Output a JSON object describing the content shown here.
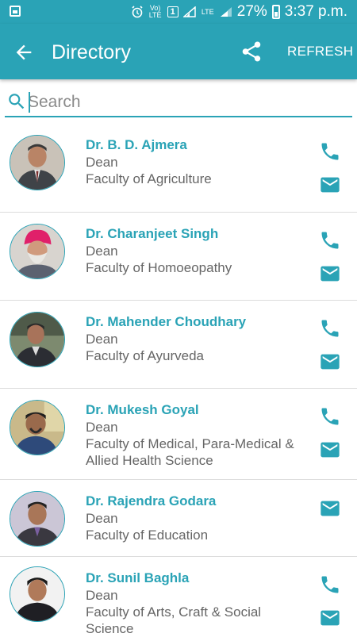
{
  "status_bar": {
    "volte": "Vo) LTE",
    "sim": "1",
    "lte": "LTE",
    "battery_percent": "27%",
    "time": "3:37 p.m."
  },
  "app_bar": {
    "title": "Directory",
    "refresh_label": "REFRESH"
  },
  "search": {
    "placeholder": "Search"
  },
  "colors": {
    "primary": "#2aa3b6",
    "text_secondary": "#666666"
  },
  "contacts": [
    {
      "name": "Dr. B. D. Ajmera",
      "designation": "Dean",
      "faculty": "Faculty of Agriculture",
      "has_phone": true
    },
    {
      "name": "Dr. Charanjeet Singh",
      "designation": "Dean",
      "faculty": "Faculty of Homoeopathy",
      "has_phone": true
    },
    {
      "name": "Dr. Mahender Choudhary",
      "designation": "Dean",
      "faculty": "Faculty of Ayurveda",
      "has_phone": true
    },
    {
      "name": "Dr. Mukesh Goyal",
      "designation": "Dean",
      "faculty": "Faculty of Medical, Para-Medical & Allied Health Science",
      "has_phone": true
    },
    {
      "name": "Dr. Rajendra Godara",
      "designation": "Dean",
      "faculty": "Faculty of Education",
      "has_phone": false
    },
    {
      "name": "Dr. Sunil Baghla",
      "designation": "Dean",
      "faculty": "Faculty of Arts, Craft & Social Science",
      "has_phone": true
    }
  ]
}
